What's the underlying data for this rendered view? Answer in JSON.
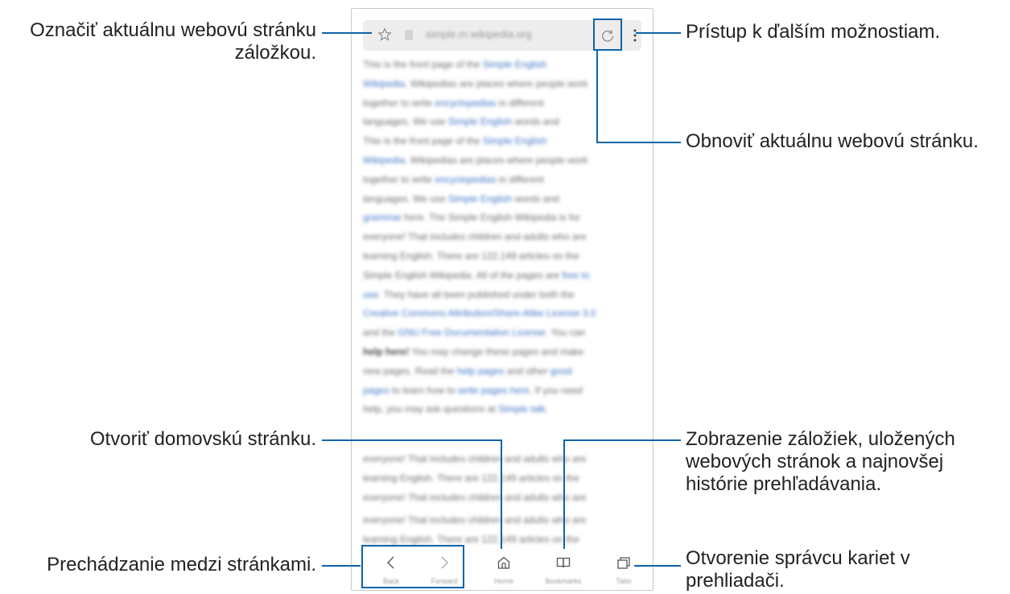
{
  "browser": {
    "url": "simple.m.wikipedia.org",
    "icons": {
      "bookmark": "star-icon",
      "refresh": "refresh-icon",
      "more": "more-vertical-icon",
      "back": "chevron-left-icon",
      "forward": "chevron-right-icon",
      "home": "home-icon",
      "bookmarks": "book-icon",
      "tabs": "tabs-icon"
    },
    "nav": {
      "back": "Back",
      "forward": "Forward",
      "home": "Home",
      "bookmarks": "Bookmarks",
      "tabs": "Tabs"
    }
  },
  "page_text": {
    "lines": [
      [
        "This is the front page of the ",
        "Simple English"
      ],
      [
        "Wikipedia",
        ". Wikipedias are places where people work"
      ],
      [
        "together to write ",
        "encyclopedias",
        " in different"
      ],
      [
        "languages. We use ",
        "Simple English",
        " words and"
      ],
      [
        "This is the front page of the ",
        "Simple English"
      ],
      [
        "Wikipedia",
        ". Wikipedias are places where people work"
      ],
      [
        "together to write ",
        "encyclopedias",
        " in different"
      ],
      [
        "languages. We use ",
        "Simple English",
        " words and"
      ],
      [
        "grammar",
        " here. The Simple English Wikipedia is for"
      ],
      [
        "everyone! That includes children and adults who are"
      ],
      [
        "learning English. There are 122,149 articles on the"
      ],
      [
        "Simple English Wikipedia. All of the pages are ",
        "free to"
      ],
      [
        "use",
        ". They have all been published under both the"
      ],
      [
        "Creative Commons Attribution/Share-Alike License 3.0"
      ],
      [
        "and the ",
        "GNU Free Documentation License",
        ". You can"
      ],
      [
        "help here!",
        " You may change these pages and make"
      ],
      [
        "new pages. Read the ",
        "help pages",
        " and other ",
        "good"
      ],
      [
        "pages",
        " to learn how to ",
        "write pages here",
        ". If you need"
      ],
      [
        "help, you may ask questions at ",
        "Simple talk",
        "."
      ]
    ],
    "lines2": [
      "everyone! That includes children and adults who are",
      "learning English. There are 122,149 articles on the",
      "everyone! That includes children and adults who are"
    ],
    "lines3": [
      "everyone! That includes children and adults who are",
      "learning English. There are 122,149 articles on the"
    ]
  },
  "callouts": {
    "bookmark_page": "Označiť aktuálnu webovú stránku záložkou.",
    "more_options": "Prístup k ďalším možnostiam.",
    "refresh_page": "Obnoviť aktuálnu webovú stránku.",
    "open_home": "Otvoriť domovskú stránku.",
    "bookmarks_view": "Zobrazenie záložiek, uložených webových stránok a najnovšej histórie prehľadávania.",
    "navigate_pages": "Prechádzanie medzi stránkami.",
    "tab_manager": "Otvorenie správcu kariet v prehliadači."
  },
  "colors": {
    "accent": "#0f63a8",
    "link": "#3f74c6"
  }
}
